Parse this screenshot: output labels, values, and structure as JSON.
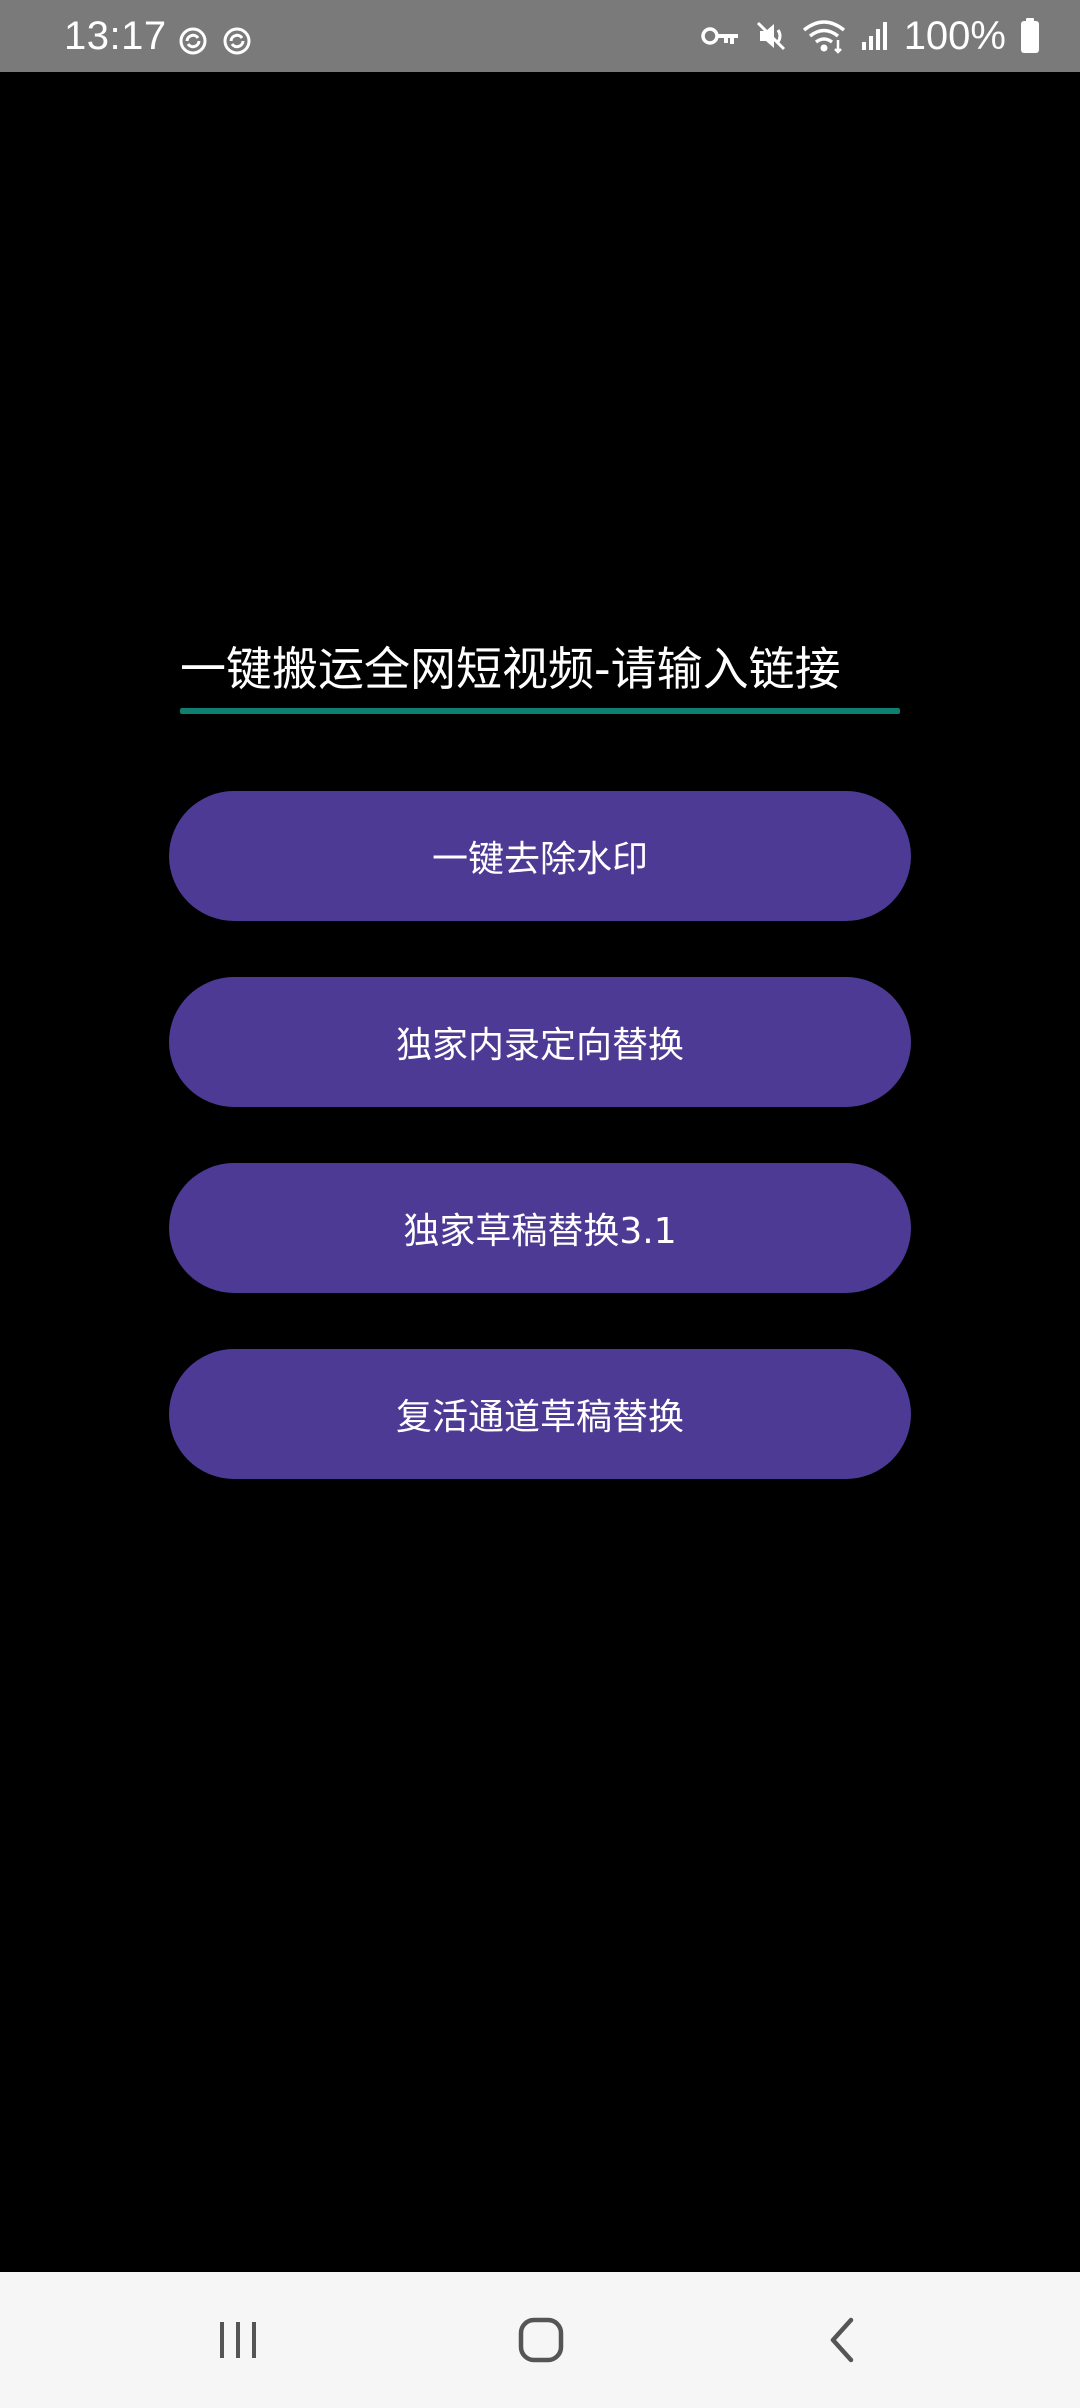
{
  "status_bar": {
    "time": "13:17",
    "battery": "100%",
    "icons_left": [
      "sync-icon",
      "sync-icon"
    ],
    "icons_right": [
      "key-icon",
      "vibrate-icon",
      "wifi-icon",
      "signal-icon",
      "battery-icon"
    ]
  },
  "main": {
    "link_input": {
      "value": "",
      "placeholder": "一键搬运全网短视频-请输入链接"
    },
    "buttons": [
      {
        "label": "一键去除水印"
      },
      {
        "label": "独家内录定向替换"
      },
      {
        "label": "独家草稿替换3.1"
      },
      {
        "label": "复活通道草稿替换"
      }
    ]
  },
  "nav_bar": {
    "icons": [
      "recents-icon",
      "home-icon",
      "back-icon"
    ]
  },
  "colors": {
    "background": "#000000",
    "status_bar": "#7a7a7a",
    "button": "#4c3a94",
    "input_underline": "#0f7f72",
    "nav_bar": "#f6f6f6"
  }
}
